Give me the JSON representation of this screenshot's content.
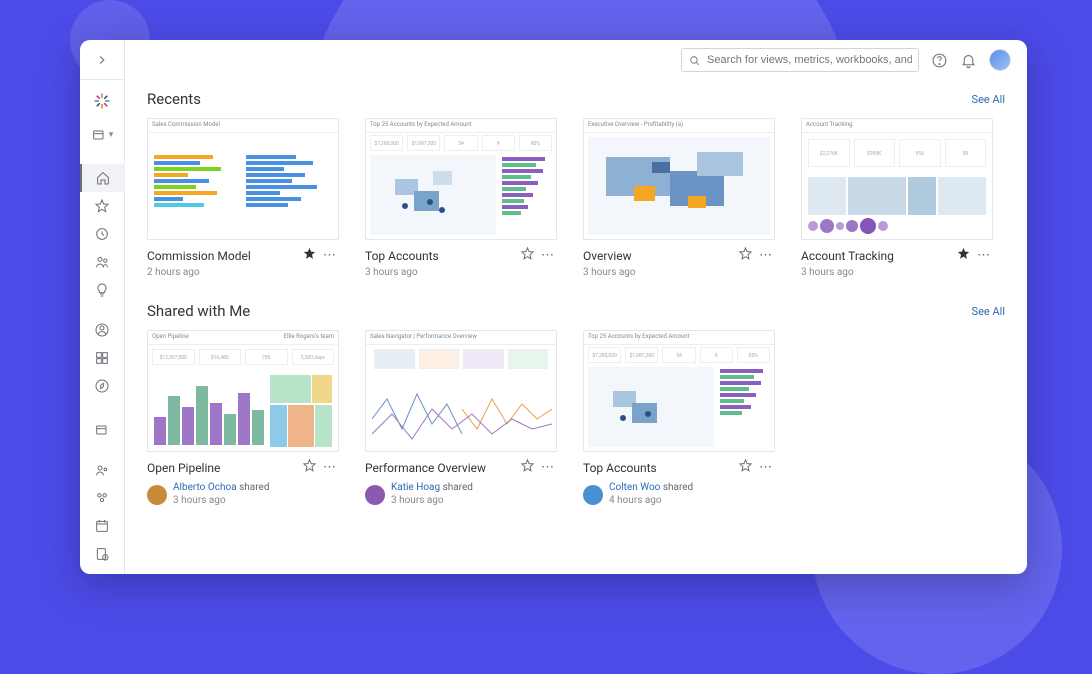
{
  "search": {
    "placeholder": "Search for views, metrics, workbooks, and more"
  },
  "sections": {
    "recents": {
      "title": "Recents",
      "see_all": "See All",
      "cards": [
        {
          "title": "Commission Model",
          "time": "2 hours ago",
          "starred": true
        },
        {
          "title": "Top Accounts",
          "time": "3 hours ago",
          "starred": false
        },
        {
          "title": "Overview",
          "time": "3 hours ago",
          "starred": false
        },
        {
          "title": "Account Tracking",
          "time": "3 hours ago",
          "starred": true
        }
      ]
    },
    "shared": {
      "title": "Shared with Me",
      "see_all": "See All",
      "cards": [
        {
          "title": "Open Pipeline",
          "shared_by": "Alberto Ochoa",
          "action": "shared",
          "time": "3 hours ago",
          "starred": false,
          "avatar_color": "#c98b3a"
        },
        {
          "title": "Performance Overview",
          "shared_by": "Katie Hoag",
          "action": "shared",
          "time": "3 hours ago",
          "starred": false,
          "avatar_color": "#8a5ab0"
        },
        {
          "title": "Top Accounts",
          "shared_by": "Colten Woo",
          "action": "shared",
          "time": "4 hours ago",
          "starred": false,
          "avatar_color": "#4a8fd6"
        }
      ]
    }
  },
  "thumbnails": {
    "commission_model": {
      "title": "Sales Commission Model"
    },
    "top_accounts": {
      "title": "Top 25 Accounts by Expected Amount",
      "row": [
        "$7,280,000",
        "$1,087,200",
        "54",
        "9",
        "80%"
      ]
    },
    "overview": {
      "title": "Executive Overview - Profitability (a)"
    },
    "account_tracking": {
      "title": "Account Tracking",
      "row": [
        "$2,276K",
        "$395K",
        "956",
        "58"
      ]
    },
    "open_pipeline": {
      "title": "Open Pipeline",
      "sub": "Ellie Rogers's team",
      "row": [
        "$12,907,000",
        "$16,480",
        "785",
        "3,500 days"
      ]
    },
    "performance_overview": {
      "title": "Sales Navigator | Performance Overview"
    }
  }
}
